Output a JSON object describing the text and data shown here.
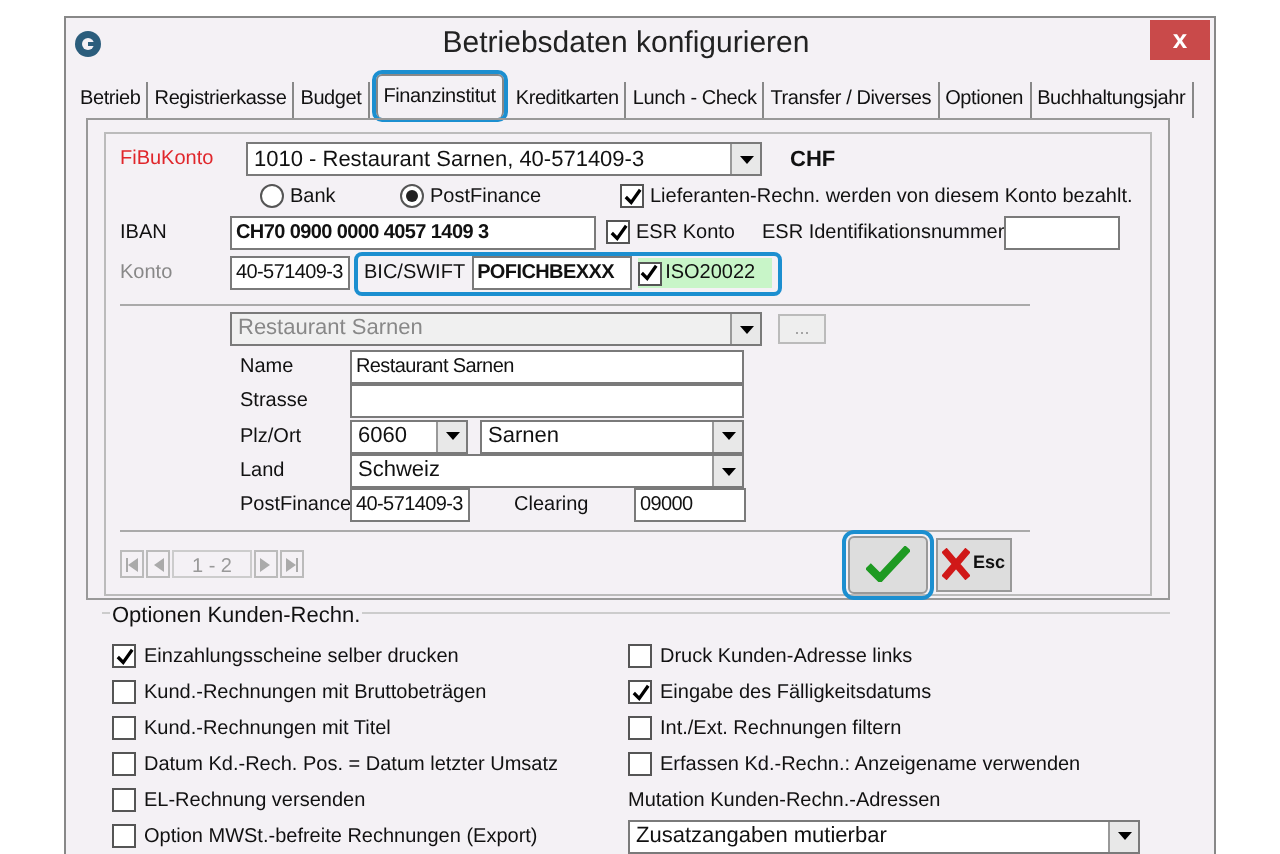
{
  "window": {
    "title": "Betriebsdaten konfigurieren",
    "close": "x"
  },
  "tabs": [
    {
      "label": "Betrieb",
      "selected": false,
      "highlighted": false
    },
    {
      "label": "Registrierkasse",
      "selected": false,
      "highlighted": false
    },
    {
      "label": "Budget",
      "selected": false,
      "highlighted": false
    },
    {
      "label": "Finanzinstitut",
      "selected": true,
      "highlighted": true
    },
    {
      "label": "Kreditkarten",
      "selected": false,
      "highlighted": false
    },
    {
      "label": "Lunch - Check",
      "selected": false,
      "highlighted": false
    },
    {
      "label": "Transfer / Diverses",
      "selected": false,
      "highlighted": false
    },
    {
      "label": "Optionen",
      "selected": false,
      "highlighted": false
    },
    {
      "label": "Buchhaltungsjahr",
      "selected": false,
      "highlighted": false
    }
  ],
  "fibukonto": {
    "label": "FiBuKonto",
    "value": "1010 - Restaurant Sarnen, 40-571409-3",
    "currency": "CHF"
  },
  "account_type": [
    {
      "label": "Bank",
      "selected": false
    },
    {
      "label": "PostFinance",
      "selected": true
    }
  ],
  "supplier_payment": {
    "label": "Lieferanten-Rechn. werden von diesem Konto bezahlt.",
    "checked": true
  },
  "iban": {
    "label": "IBAN",
    "value": "CH70 0900 0000 4057 1409 3"
  },
  "esr_konto": {
    "label": "ESR Konto",
    "checked": true
  },
  "esr_id": {
    "label": "ESR Identifikationsnummer"
  },
  "konto": {
    "label": "Konto",
    "value": "40-571409-3"
  },
  "bic_group": {
    "highlighted": true,
    "label": "BIC/SWIFT",
    "value": "POFICHBEXXX",
    "iso": {
      "label": "ISO20022",
      "checked": true
    }
  },
  "bank_select": {
    "value": "Restaurant Sarnen",
    "button": "..."
  },
  "address": {
    "name": {
      "label": "Name",
      "value": "Restaurant Sarnen"
    },
    "strasse": {
      "label": "Strasse"
    },
    "plz_ort": {
      "label": "Plz/Ort",
      "plz": "6060",
      "ort": "Sarnen"
    },
    "land": {
      "label": "Land",
      "value": "Schweiz"
    },
    "postfinance": {
      "label": "PostFinance",
      "value": "40-571409-3"
    },
    "clearing": {
      "label": "Clearing",
      "value": "09000"
    }
  },
  "pager": {
    "label": "1 - 2"
  },
  "ok_button": {
    "highlighted": true
  },
  "esc_button": {
    "label": "Esc"
  },
  "options": {
    "title": "Optionen Kunden-Rechn.",
    "left": [
      {
        "label": "Einzahlungsscheine selber drucken",
        "checked": true
      },
      {
        "label": "Kund.-Rechnungen mit Bruttobeträgen",
        "checked": false
      },
      {
        "label": "Kund.-Rechnungen mit Titel",
        "checked": false
      },
      {
        "label": "Datum Kd.-Rech. Pos. = Datum letzter Umsatz",
        "checked": false
      },
      {
        "label": "EL-Rechnung versenden",
        "checked": false
      },
      {
        "label": "Option MWSt.-befreite Rechnungen (Export)",
        "checked": false
      }
    ],
    "right": [
      {
        "kind": "checkbox",
        "label": "Druck Kunden-Adresse links",
        "checked": false
      },
      {
        "kind": "checkbox",
        "label": "Eingabe des Fälligkeitsdatums",
        "checked": true
      },
      {
        "kind": "checkbox",
        "label": "Int./Ext. Rechnungen filtern",
        "checked": false
      },
      {
        "kind": "checkbox",
        "label": "Erfassen Kd.-Rechn.: Anzeigename verwenden",
        "checked": false
      },
      {
        "kind": "label",
        "label": "Mutation Kunden-Rechn.-Adressen"
      },
      {
        "kind": "select",
        "label": "Zusatzangaben mutierbar"
      }
    ]
  }
}
